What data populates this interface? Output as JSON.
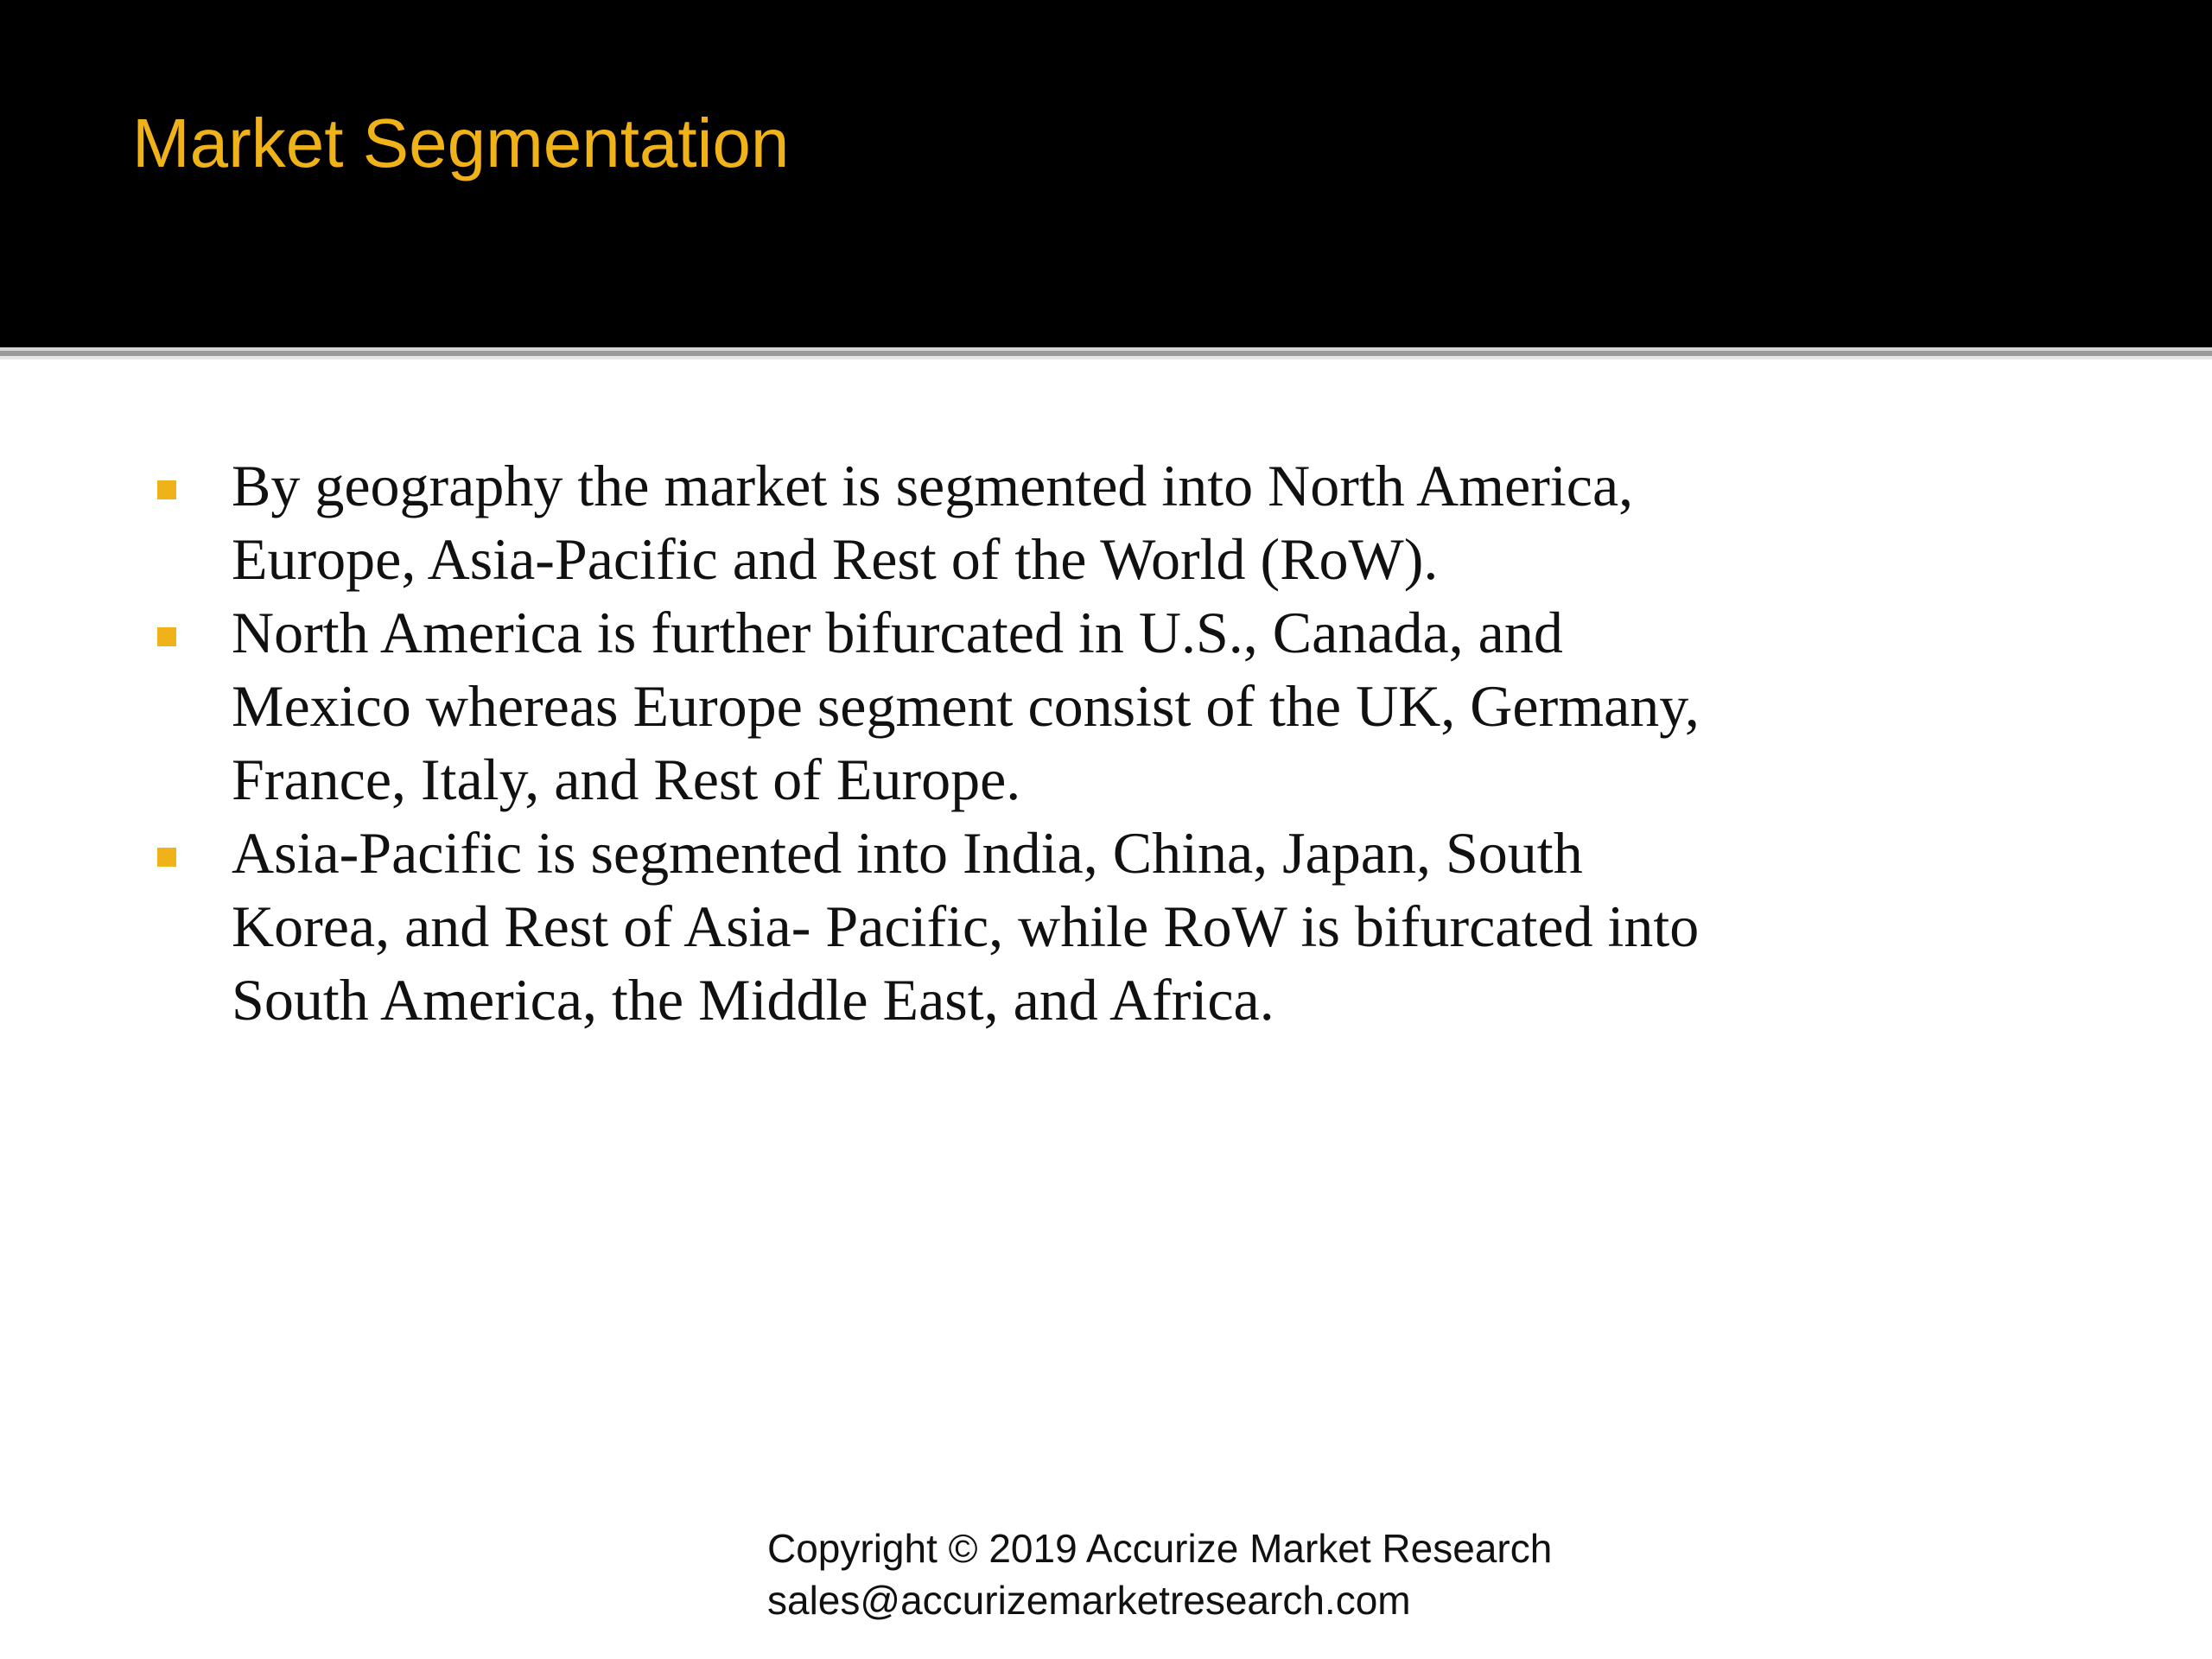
{
  "slide": {
    "title": "Market Segmentation",
    "bullets": [
      {
        "lines": [
          "By geography the market is segmented into North America,",
          "Europe, Asia-Pacific and Rest of the World (RoW)."
        ]
      },
      {
        "lines": [
          "North America is further bifurcated in U.S., Canada, and",
          "Mexico whereas Europe segment consist of the UK, Germany,",
          "France, Italy, and Rest of Europe."
        ]
      },
      {
        "lines": [
          "Asia-Pacific is segmented into India, China, Japan, South",
          "Korea, and Rest of Asia- Pacific, while RoW is bifurcated into",
          "South America, the Middle East, and Africa."
        ]
      }
    ],
    "footer": {
      "copyright": "Copyright © 2019 Accurize Market Research",
      "email": "sales@accurizemarketresearch.com"
    }
  },
  "colors": {
    "header_background": "#000000",
    "title_color": "#f0b219",
    "bullet_color": "#f0b219",
    "body_text": "#111111"
  }
}
